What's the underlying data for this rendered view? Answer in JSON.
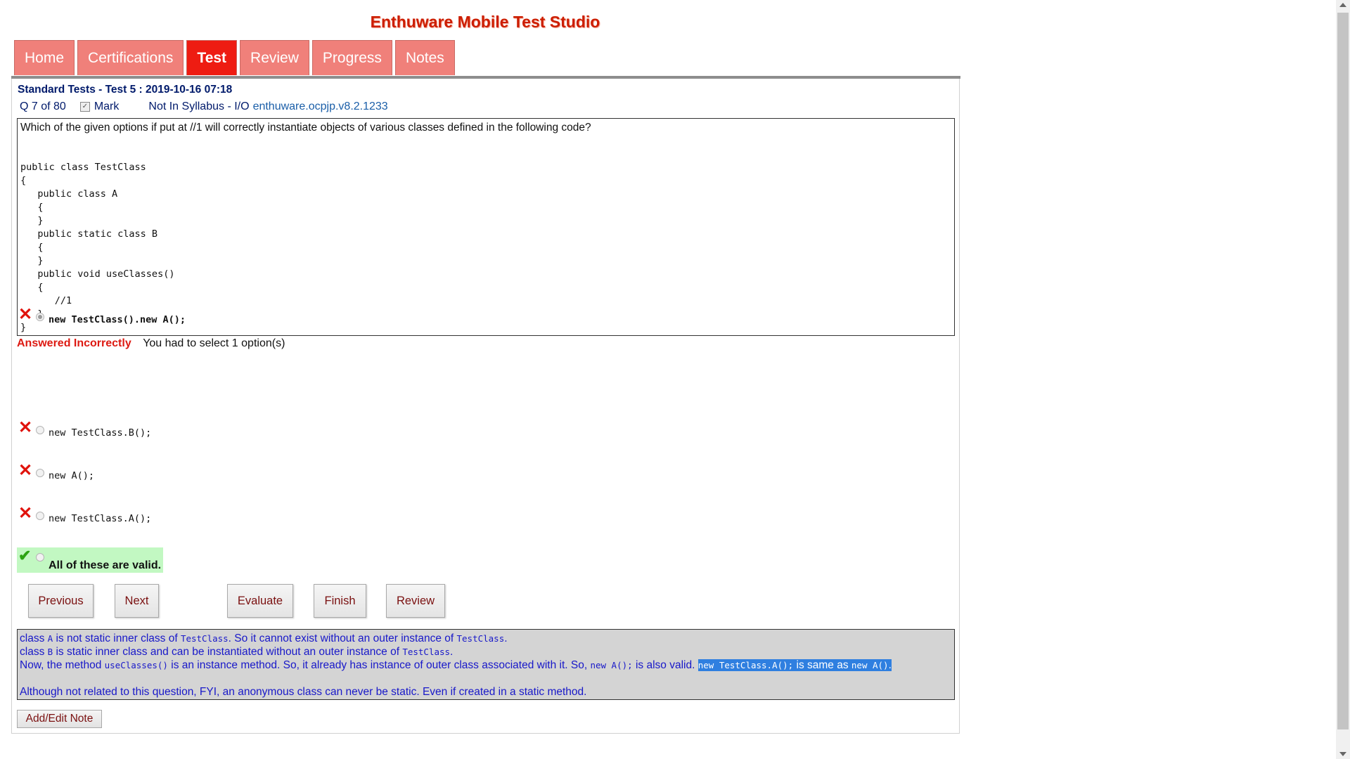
{
  "app_title": "Enthuware Mobile Test Studio",
  "tabs": [
    {
      "label": "Home",
      "active": false
    },
    {
      "label": "Certifications",
      "active": false
    },
    {
      "label": "Test",
      "active": true
    },
    {
      "label": "Review",
      "active": false
    },
    {
      "label": "Progress",
      "active": false
    },
    {
      "label": "Notes",
      "active": false
    }
  ],
  "test_header": "Standard Tests - Test 5 : 2019-10-16 07:18",
  "question_meta": {
    "counter": "Q 7 of 80",
    "mark_label": "Mark",
    "mark_checked": true,
    "topic": "Not In Syllabus - I/O",
    "question_id": "enthuware.ocpjp.v8.2.1233"
  },
  "question": {
    "text": "Which of the given options if put at //1 will correctly instantiate objects of various classes defined in the following code?",
    "code": "public class TestClass\n{\n   public class A\n   {\n   }\n   public static class B\n   {\n   }\n   public void useClasses()\n   {\n      //1\n   }\n}"
  },
  "result": {
    "status": "Answered Incorrectly",
    "requirement": "You had to select 1 option(s)"
  },
  "options": [
    {
      "text": "new TestClass().new A();",
      "selected": true,
      "status": "wrong"
    },
    {
      "text": "new TestClass.B();",
      "selected": false,
      "status": "wrong"
    },
    {
      "text": "new A();",
      "selected": false,
      "status": "wrong"
    },
    {
      "text": "new TestClass.A();",
      "selected": false,
      "status": "wrong"
    },
    {
      "text": "All of these are valid.",
      "selected": false,
      "status": "correct"
    }
  ],
  "buttons": {
    "previous": "Previous",
    "next": "Next",
    "evaluate": "Evaluate",
    "finish": "Finish",
    "review": "Review"
  },
  "explanation": {
    "l1_a": "class ",
    "l1_b": "A",
    "l1_c": " is not static inner class of ",
    "l1_d": "TestClass",
    "l1_e": ". So it cannot exist without an outer instance of ",
    "l1_f": "TestClass",
    "l1_g": ".",
    "l2_a": "class ",
    "l2_b": "B",
    "l2_c": " is static inner class and can be instantiated without an outer instance of ",
    "l2_d": "TestClass",
    "l2_e": ".",
    "l3_a": "Now, the method ",
    "l3_b": "useClasses()",
    "l3_c": " is an instance method. So, it already has instance of outer class associated with it. So, ",
    "l3_d": "new A();",
    "l3_e": " is also valid. ",
    "l3_f": "new TestClass.A();",
    "l3_g": " is same as ",
    "l3_h": "new A()",
    "l3_i": ".",
    "l4": "Although not related to this question, FYI, an anonymous class can never be static. Even if created in a static method."
  },
  "note_button": "Add/Edit Note",
  "colors": {
    "title": "#cc1d00",
    "tab": "#f0807a",
    "tab_active": "#ee1c12",
    "incorrect": "#dd1a12",
    "correct_bg": "#c2f8c2",
    "explanation_text": "#1818c9",
    "explanation_bg": "#d4d4d4"
  },
  "icons": {
    "wrong": "x-mark-icon",
    "correct": "check-mark-icon"
  }
}
